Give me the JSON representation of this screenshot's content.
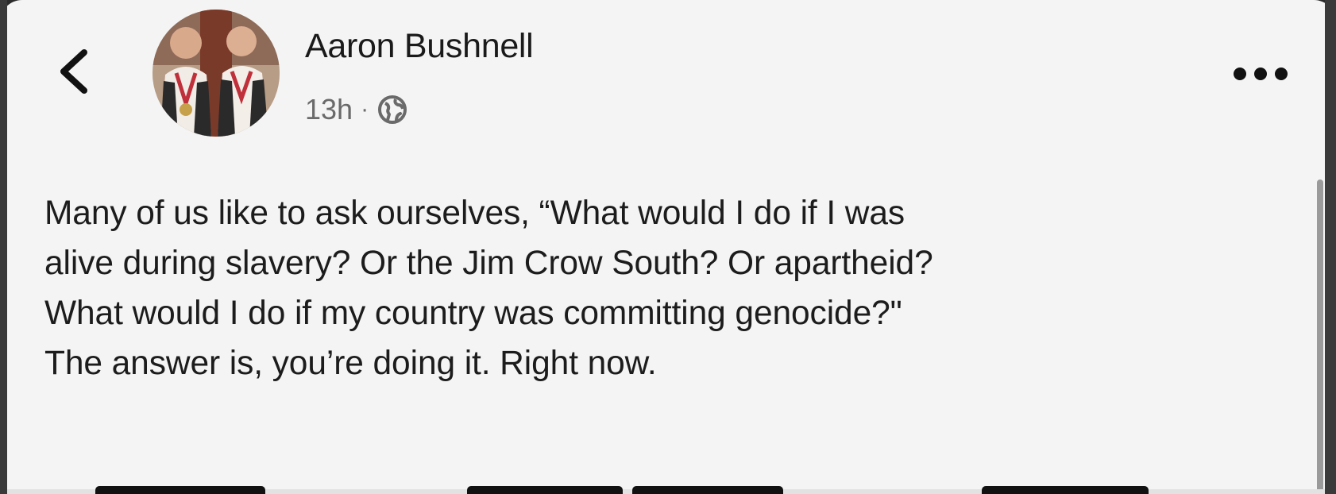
{
  "header": {
    "back_icon": "chevron-left-icon",
    "author_name": "Aaron Bushnell",
    "post_time": "13h",
    "separator": "·",
    "audience_icon": "globe-icon",
    "more_icon": "more-horizontal-icon"
  },
  "post": {
    "lines": [
      "Many of us like to ask ourselves, “What would I do if I was",
      "alive during slavery? Or the Jim Crow South? Or apartheid?",
      "What would I do if my country was committing genocide?\"",
      "The answer is, you’re doing it. Right now."
    ]
  },
  "colors": {
    "background": "#f4f4f4",
    "text": "#1c1c1c",
    "secondary_text": "#6a6a6a"
  }
}
